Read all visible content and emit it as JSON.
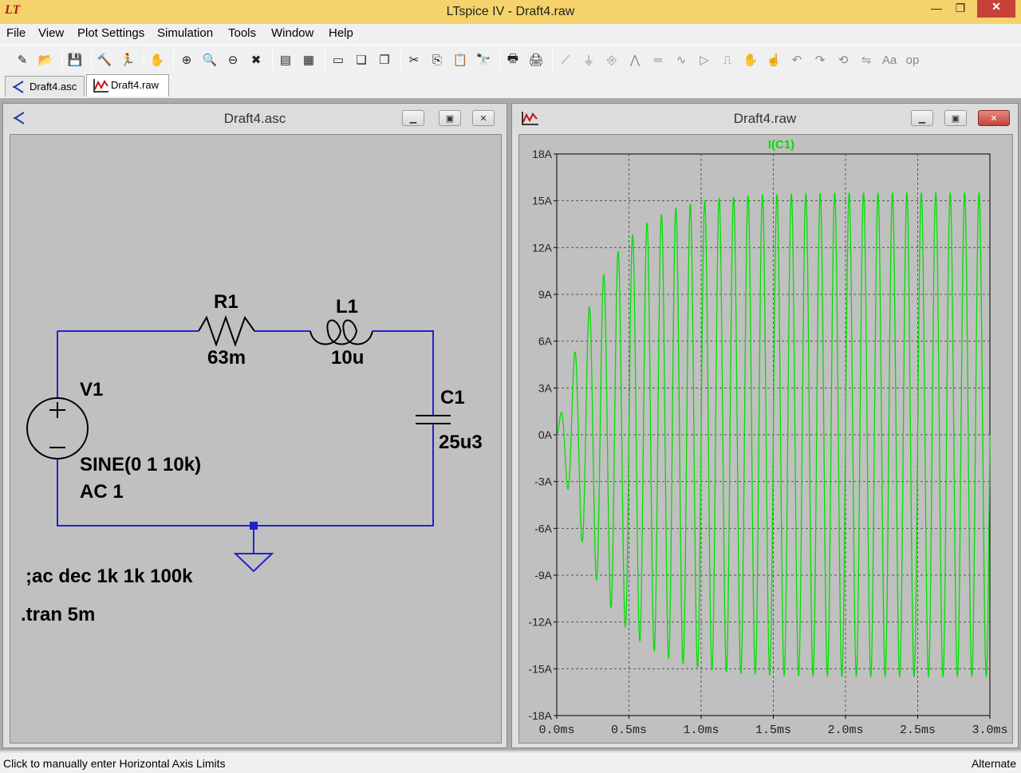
{
  "window": {
    "title": "LTspice IV - Draft4.raw",
    "app_logo": "LT",
    "min_glyph": "—",
    "max_glyph": "❐",
    "close_glyph": "✕"
  },
  "menu": [
    "File",
    "View",
    "Plot Settings",
    "Simulation",
    "Tools",
    "Window",
    "Help"
  ],
  "toolbar_icons": [
    "new-schematic-icon",
    "open-icon",
    "save-icon",
    "control-panel-icon",
    "run-icon",
    "pan-icon",
    "zoom-in-icon",
    "zoom-full-icon",
    "zoom-out-icon",
    "zoom-cancel-icon",
    "autoscale-icon",
    "grid-icon",
    "tile-horizontal-icon",
    "cascade-icon",
    "tile-vertical-icon",
    "cut-icon",
    "copy-icon",
    "paste-icon",
    "find-icon",
    "print-preview-icon",
    "print-icon",
    "wire-icon",
    "ground-icon",
    "label-icon",
    "resistor-icon",
    "capacitor-icon",
    "inductor-icon",
    "diode-icon",
    "component-icon",
    "move-icon",
    "drag-icon",
    "undo-icon",
    "redo-icon",
    "rotate-icon",
    "mirror-icon",
    "text-icon",
    "spice-directive-icon"
  ],
  "tabs": [
    {
      "label": "Draft4.asc"
    },
    {
      "label": "Draft4.raw"
    }
  ],
  "schematic": {
    "title": "Draft4.asc",
    "components": {
      "r1_name": "R1",
      "r1_value": "63m",
      "l1_name": "L1",
      "l1_value": "10u",
      "c1_name": "C1",
      "c1_value": "25u3",
      "v1_name": "V1",
      "v1_value": "SINE(0 1 10k)",
      "v1_ac": "AC 1"
    },
    "directives": {
      "ac": ";ac dec 1k 1k 100k",
      "tran": ".tran 5m"
    },
    "wire_color": "#2323c8"
  },
  "waveform": {
    "title": "Draft4.raw",
    "trace_color": "#00e000"
  },
  "chart_data": {
    "type": "line",
    "title": "",
    "series": [
      {
        "name": "I(C1)",
        "description": "sinusoid ~10kHz, envelope rising from 0 to ~15.5A by ~1.0ms"
      }
    ],
    "xlabel": "",
    "ylabel": "",
    "xlim": [
      0,
      3.0
    ],
    "ylim": [
      -18,
      18
    ],
    "x_unit": "ms",
    "y_unit": "A",
    "x_ticks": [
      "0.0ms",
      "0.5ms",
      "1.0ms",
      "1.5ms",
      "2.0ms",
      "2.5ms",
      "3.0ms"
    ],
    "y_ticks": [
      "18A",
      "15A",
      "12A",
      "9A",
      "6A",
      "3A",
      "0A",
      "-3A",
      "-6A",
      "-9A",
      "-12A",
      "-15A",
      "-18A"
    ],
    "frequency_khz": 10,
    "steady_amplitude": 15.5,
    "grid": true
  },
  "status": {
    "left": "Click to manually enter Horizontal Axis Limits",
    "right": "Alternate"
  }
}
